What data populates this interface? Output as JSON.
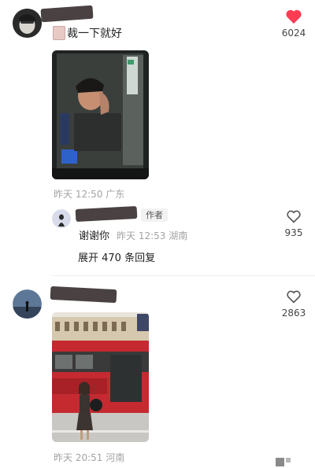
{
  "comments": [
    {
      "text": "裁一下就好",
      "meta": "昨天 12:50 广东",
      "likes": "6024",
      "liked": true,
      "reply": {
        "author_tag": "作者",
        "text": "谢谢你",
        "meta": "昨天 12:53 湖南",
        "likes": "935"
      },
      "expand": "展开 470 条回复"
    },
    {
      "meta": "昨天 20:51 河南",
      "likes": "2863",
      "liked": false
    }
  ],
  "colors": {
    "like_active": "#ff3c53",
    "like_inactive": "#555555",
    "meta": "#a3a3a3"
  }
}
